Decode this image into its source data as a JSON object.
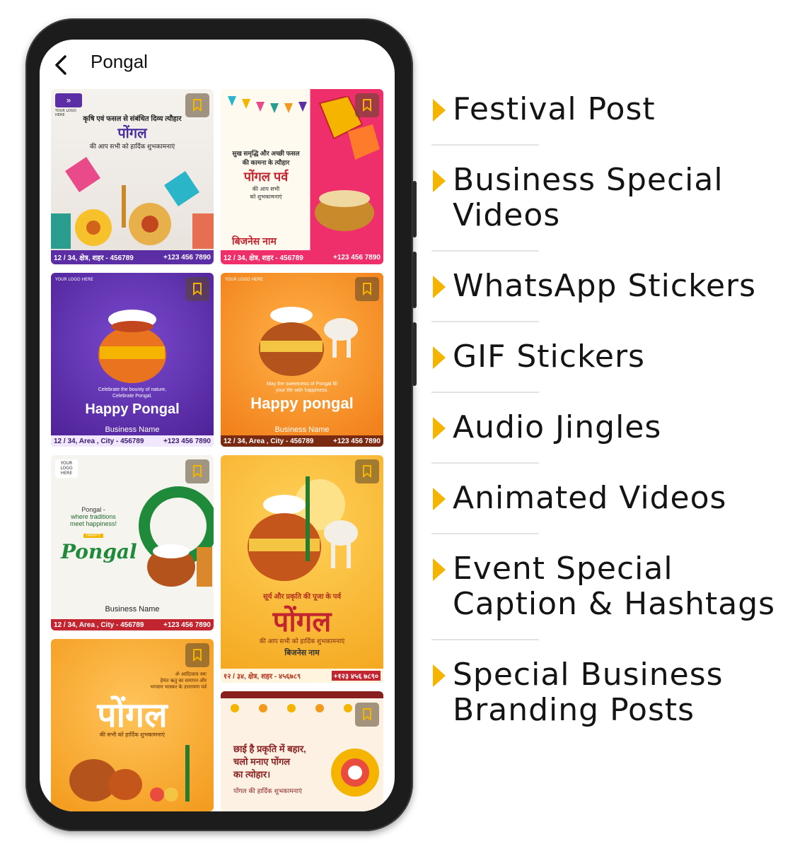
{
  "header": {
    "title": "Pongal"
  },
  "cards": [
    {
      "lines": [
        "कृषि एवं फसल से संबंधित दिव्य त्यौहार",
        "पोंगल",
        "की आप सभी को हार्दिक शुभकामनाएं"
      ],
      "logo": "YOUR LOGO HERE",
      "address": "12 / 34, क्षेत्र, शहर - 456789",
      "phone": "+123 456 7890"
    },
    {
      "lines": [
        "सुख समृद्धि और अच्छी फसल",
        "की कामना के त्यौहार",
        "पोंगल पर्व",
        "की आप सभी",
        "को शुभकामनाएं",
        "बिजनेस नाम"
      ],
      "address": "12 / 34, क्षेत्र, शहर - 456789",
      "phone": "+123 456 7890"
    },
    {
      "lines": [
        "Celebrate the bounty of nature,",
        "Celebrate Pongal.",
        "Happy Pongal",
        "Business Name"
      ],
      "logo": "YOUR LOGO HERE",
      "address": "12 / 34, Area , City - 456789",
      "phone": "+123 456 7890"
    },
    {
      "lines": [
        "May the sweetness of Pongal fill",
        "your life with happiness.",
        "Happy pongal",
        "Business Name"
      ],
      "logo": "YOUR LOGO HERE",
      "address": "12 / 34, Area , City - 456789",
      "phone": "+123 456 7890"
    },
    {
      "lines": [
        "Pongal -",
        "where traditions",
        "meet happiness!",
        "HAPPY",
        "Pongal",
        "Business Name"
      ],
      "logo": "YOUR LOGO HERE",
      "address": "12 / 34, Area , City - 456789",
      "phone": "+123 456 7890"
    },
    {
      "lines": [
        "सूर्य और प्रकृति की पूजा के पर्व",
        "पोंगल",
        "की आप सभी को हार्दिक शुभकामनाएं",
        "बिजनेस नाम"
      ],
      "address": "१२ / ३४, क्षेत्र, शहर - ४५६७८९",
      "phone": "+१२३ ४५६ ७८९०"
    },
    {
      "lines": [
        "ॐ आदित्याय नमः",
        "हेमंत ऋतु का समापन और",
        "भगवान भास्कर के उत्तरायण पर्व",
        "पोंगल",
        "की सभी को हार्दिक शुभकामनाएं"
      ]
    },
    {
      "lines": [
        "छाई है प्रकृति में बहार,",
        "चलो मनाए पोंगल",
        "का त्योहार।",
        "पोंगल की हार्दिक शुभकामनाएं"
      ]
    }
  ],
  "features": [
    {
      "lines": [
        "Festival Post"
      ]
    },
    {
      "lines": [
        "Business Special",
        "Videos"
      ]
    },
    {
      "lines": [
        "WhatsApp Stickers"
      ]
    },
    {
      "lines": [
        "GIF Stickers"
      ]
    },
    {
      "lines": [
        "Audio Jingles"
      ]
    },
    {
      "lines": [
        "Animated Videos"
      ]
    },
    {
      "lines": [
        "Event Special",
        "Caption & Hashtags"
      ]
    },
    {
      "lines": [
        "Special Business",
        "Branding Posts"
      ]
    }
  ],
  "colors": {
    "accent": "#f4b400",
    "text": "#141414",
    "purple": "#5b2ea6",
    "orange": "#f39a1c"
  }
}
